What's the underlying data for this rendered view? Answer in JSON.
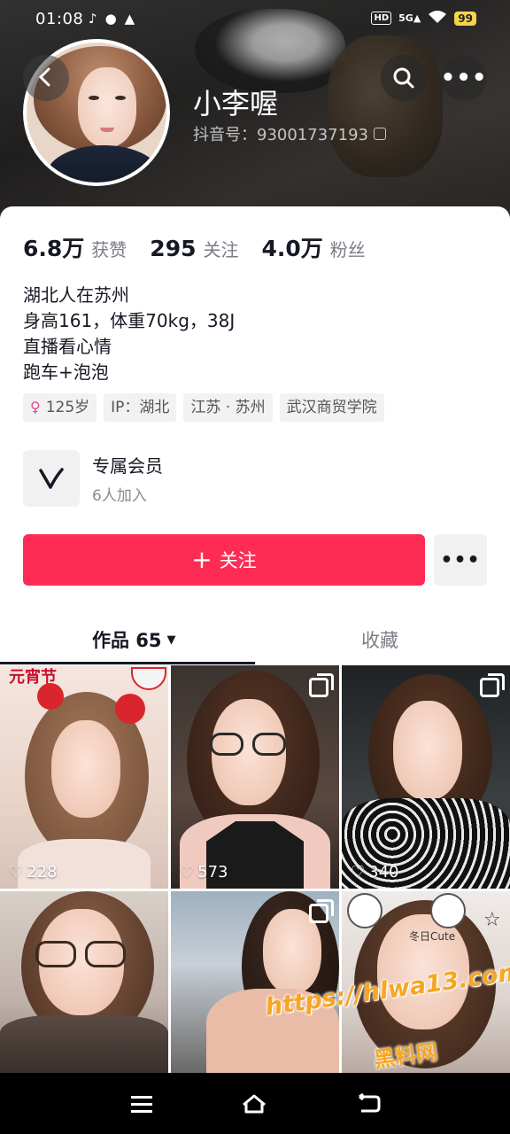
{
  "status_bar": {
    "time": "01:08",
    "network": "HD",
    "signal": "5G",
    "battery": "99"
  },
  "profile": {
    "nickname": "小李喔",
    "douyin_id": "抖音号：93001737193",
    "stats": [
      {
        "value": "6.8万",
        "label": "获赞"
      },
      {
        "value": "295",
        "label": "关注"
      },
      {
        "value": "4.0万",
        "label": "粉丝"
      }
    ],
    "bio": [
      "湖北人在苏州",
      "身高161，体重70kg，38J",
      "直播看心情",
      "跑车+泡泡"
    ],
    "tags": [
      "125岁",
      "IP：湖北",
      "江苏 · 苏州",
      "武汉商贸学院"
    ]
  },
  "member": {
    "title": "专属会员",
    "subtitle": "6人加入"
  },
  "actions": {
    "follow_label": "关注"
  },
  "tabs": {
    "works": "作品 65",
    "favorites": "收藏"
  },
  "videos": [
    {
      "likes": "228"
    },
    {
      "likes": "573"
    },
    {
      "likes": "340"
    },
    {
      "likes": ""
    },
    {
      "likes": ""
    },
    {
      "likes": ""
    }
  ],
  "tile_text": {
    "sticker_1": "元宵节",
    "sticker_2": "冬日Cute"
  },
  "watermark": {
    "url": "https://hlwa13.com",
    "name": "黑料网"
  },
  "colors": {
    "accent": "#fe2c55",
    "female": "#e2459a",
    "watermark": "#f6a623"
  }
}
